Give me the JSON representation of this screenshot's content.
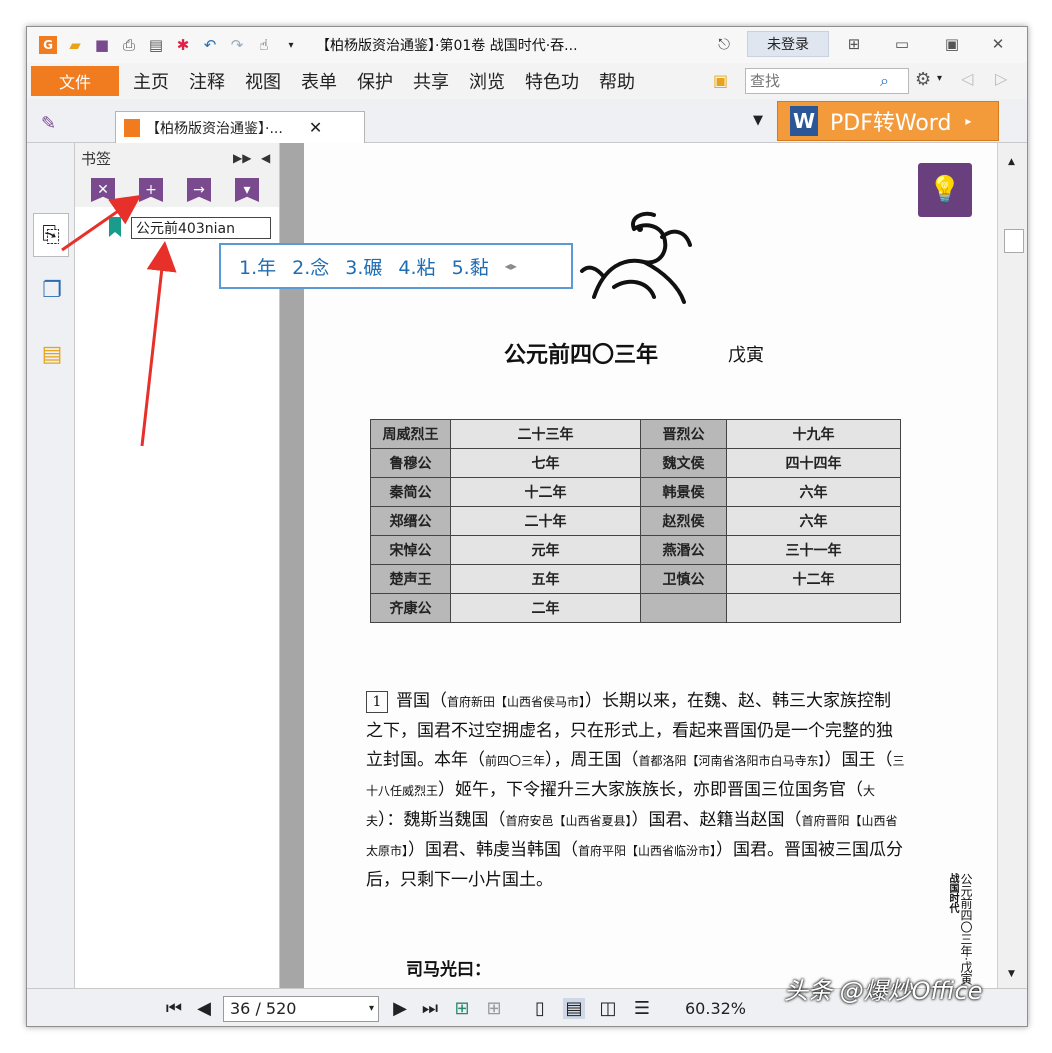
{
  "window": {
    "title": "【柏杨版资治通鉴】·第01卷 战国时代·吞...",
    "login_label": "未登录"
  },
  "menu": {
    "file_label": "文件",
    "items": [
      "主页",
      "注释",
      "视图",
      "表单",
      "保护",
      "共享",
      "浏览",
      "特色功",
      "帮助"
    ],
    "search_placeholder": "查找"
  },
  "tab": {
    "label": "【柏杨版资治通鉴】·...",
    "pdf_to_word": "PDF转Word"
  },
  "bookmark_panel": {
    "header": "书签",
    "edit_value": "公元前403nian"
  },
  "ime": {
    "candidates": [
      "1.年",
      "2.念",
      "3.碾",
      "4.粘",
      "5.黏"
    ]
  },
  "page": {
    "title": "公元前四〇三年",
    "subtitle": "戊寅",
    "table_rows": [
      [
        "周威烈王",
        "二十三年",
        "晋烈公",
        "十九年"
      ],
      [
        "鲁穆公",
        "七年",
        "魏文侯",
        "四十四年"
      ],
      [
        "秦简公",
        "十二年",
        "韩景侯",
        "六年"
      ],
      [
        "郑缙公",
        "二十年",
        "赵烈侯",
        "六年"
      ],
      [
        "宋悼公",
        "元年",
        "燕湣公",
        "三十一年"
      ],
      [
        "楚声王",
        "五年",
        "卫慎公",
        "十二年"
      ],
      [
        "齐康公",
        "二年",
        "",
        ""
      ]
    ],
    "para_num": "1",
    "paragraph": [
      {
        "t": "晋国（"
      },
      {
        "n": "首府新田【山西省侯马市】"
      },
      {
        "t": "）长期以来，在魏、赵、韩三大家族控制之下，国君不过空拥虚名，只在形式上，看起来晋国仍是一个完整的独立封国。本年（"
      },
      {
        "n": "前四〇三年"
      },
      {
        "t": "），周王国（"
      },
      {
        "n": "首都洛阳【河南省洛阳市白马寺东】"
      },
      {
        "t": "）国王（"
      },
      {
        "n": "三十八任威烈王"
      },
      {
        "t": "）姬午，下令擢升三大家族族长，亦即晋国三位国务官（"
      },
      {
        "n": "大夫"
      },
      {
        "t": "）：魏斯当魏国（"
      },
      {
        "n": "首府安邑【山西省夏县】"
      },
      {
        "t": "）国君、赵籍当赵国（"
      },
      {
        "n": "首府晋阳【山西省太原市】"
      },
      {
        "t": "）国君、韩虔当韩国（"
      },
      {
        "n": "首府平阳【山西省临汾市】"
      },
      {
        "t": "）国君。晋国被三国瓜分后，只剩下一小片国土。"
      }
    ],
    "sima": "司马光曰：",
    "side_caption": "公元前四〇三年·戊寅",
    "side_caption2": "战国时代"
  },
  "bottom": {
    "page_value": "36 / 520",
    "zoom": "60.32%"
  },
  "watermark": "头条 @爆炒Office",
  "colors": {
    "accent": "#f07c1f",
    "bookmark_purple": "#7a4a8f",
    "ime_blue": "#1f6db3",
    "arrow_red": "#e8302a"
  }
}
